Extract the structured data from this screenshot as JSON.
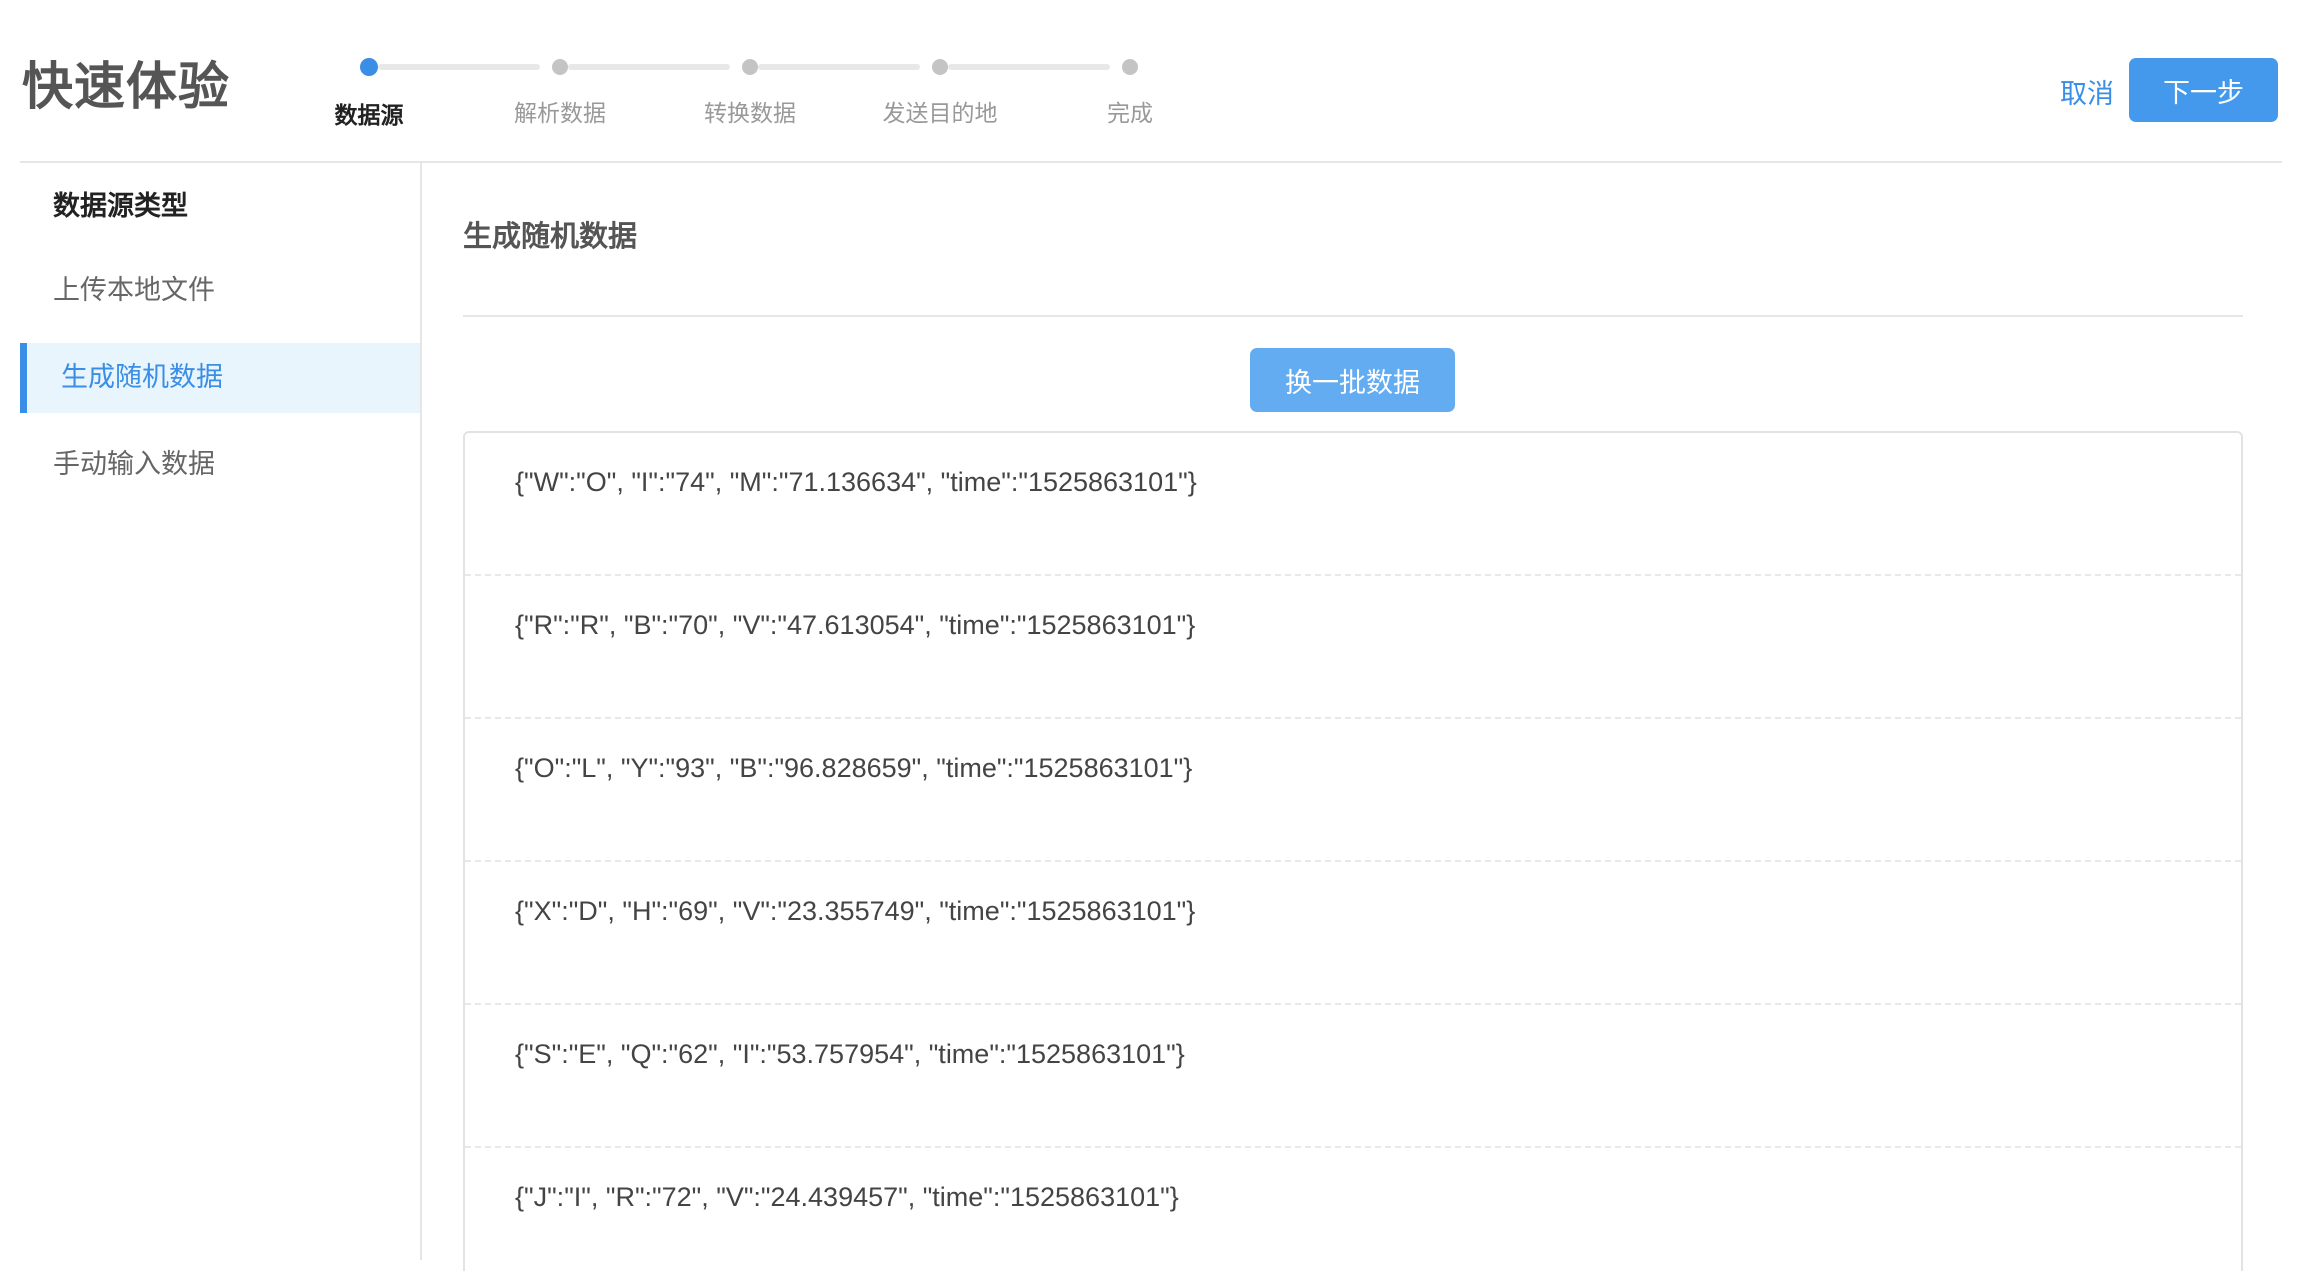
{
  "header": {
    "title": "快速体验",
    "steps": [
      {
        "label": "数据源",
        "active": true
      },
      {
        "label": "解析数据",
        "active": false
      },
      {
        "label": "转换数据",
        "active": false
      },
      {
        "label": "发送目的地",
        "active": false
      },
      {
        "label": "完成",
        "active": false
      }
    ],
    "cancel_label": "取消",
    "next_label": "下一步"
  },
  "sidebar": {
    "heading": "数据源类型",
    "items": [
      {
        "label": "上传本地文件",
        "active": false
      },
      {
        "label": "生成随机数据",
        "active": true
      },
      {
        "label": "手动输入数据",
        "active": false
      }
    ]
  },
  "main": {
    "title": "生成随机数据",
    "refresh_label": "换一批数据",
    "records": [
      "{\"W\":\"O\", \"I\":\"74\", \"M\":\"71.136634\", \"time\":\"1525863101\"}",
      "{\"R\":\"R\", \"B\":\"70\", \"V\":\"47.613054\", \"time\":\"1525863101\"}",
      "{\"O\":\"L\", \"Y\":\"93\", \"B\":\"96.828659\", \"time\":\"1525863101\"}",
      "{\"X\":\"D\", \"H\":\"69\", \"V\":\"23.355749\", \"time\":\"1525863101\"}",
      "{\"S\":\"E\", \"Q\":\"62\", \"I\":\"53.757954\", \"time\":\"1525863101\"}",
      "{\"J\":\"I\", \"R\":\"72\", \"V\":\"24.439457\", \"time\":\"1525863101\"}"
    ]
  },
  "colors": {
    "accent": "#3a8ee6",
    "primary_button": "#4599ec",
    "secondary_button": "#64acf2",
    "active_bg": "#e9f5fd"
  }
}
